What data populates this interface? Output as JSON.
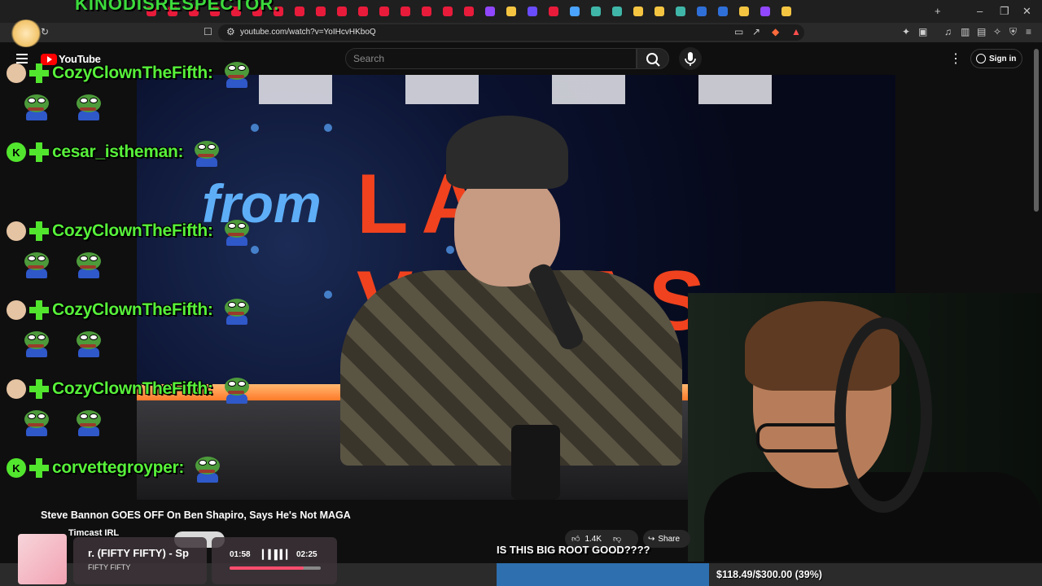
{
  "overlay": {
    "stream_title": "KINODISRESPECTOR."
  },
  "browser": {
    "url": "youtube.com/watch?v=YoIHcvHKboQ",
    "tab_colors": [
      "#e81b3b",
      "#e81b3b",
      "#e81b3b",
      "#e81b3b",
      "#e81b3b",
      "#e81b3b",
      "#e81b3b",
      "#e81b3b",
      "#e81b3b",
      "#e81b3b",
      "#e81b3b",
      "#e81b3b",
      "#e81b3b",
      "#e81b3b",
      "#e81b3b",
      "#e81b3b",
      "#9147ff",
      "#f5c542",
      "#6a4cff",
      "#e81b3b",
      "#4aa3ff",
      "#3fb6a8",
      "#3fb6a8",
      "#f5c542",
      "#f5c542",
      "#3fb6a8",
      "#2f6fd8",
      "#2f6fd8",
      "#f5c542",
      "#9147ff",
      "#f5c542"
    ]
  },
  "youtube": {
    "logo_text": "YouTube",
    "search_placeholder": "Search",
    "sign_in": "Sign in"
  },
  "chat": {
    "messages": [
      {
        "badge": "avatar",
        "username": "CozyClownTheFifth:",
        "emotes": 2
      },
      {
        "badge": "K",
        "username": "cesar_istheman:",
        "emotes": 0
      },
      {
        "badge": "avatar",
        "username": "CozyClownTheFifth:",
        "emotes": 2
      },
      {
        "badge": "avatar",
        "username": "CozyClownTheFifth:",
        "emotes": 2
      },
      {
        "badge": "avatar",
        "username": "CozyClownTheFifth:",
        "emotes": 2
      },
      {
        "badge": "K",
        "username": "corvettegroyper:",
        "emotes": 0
      }
    ]
  },
  "video": {
    "on_screen_from": "from",
    "on_screen_vegas": "LAS VEGAS",
    "title": "Steve Bannon GOES OFF On Ben Shapiro, Says He's Not MAGA",
    "channel": "Timcast IRL",
    "likes": "1.4K",
    "share": "Share"
  },
  "caption": "IS THIS BIG ROOT GOOD????",
  "now_playing": {
    "title": "r. (FIFTY FIFTY) - Sp",
    "artist": "FIFTY FIFTY",
    "current_time": "01:58",
    "duration": "02:25",
    "progress": 0.81
  },
  "goal": {
    "text": "$118.49/$300.00 (39%)",
    "progress": 0.39
  }
}
